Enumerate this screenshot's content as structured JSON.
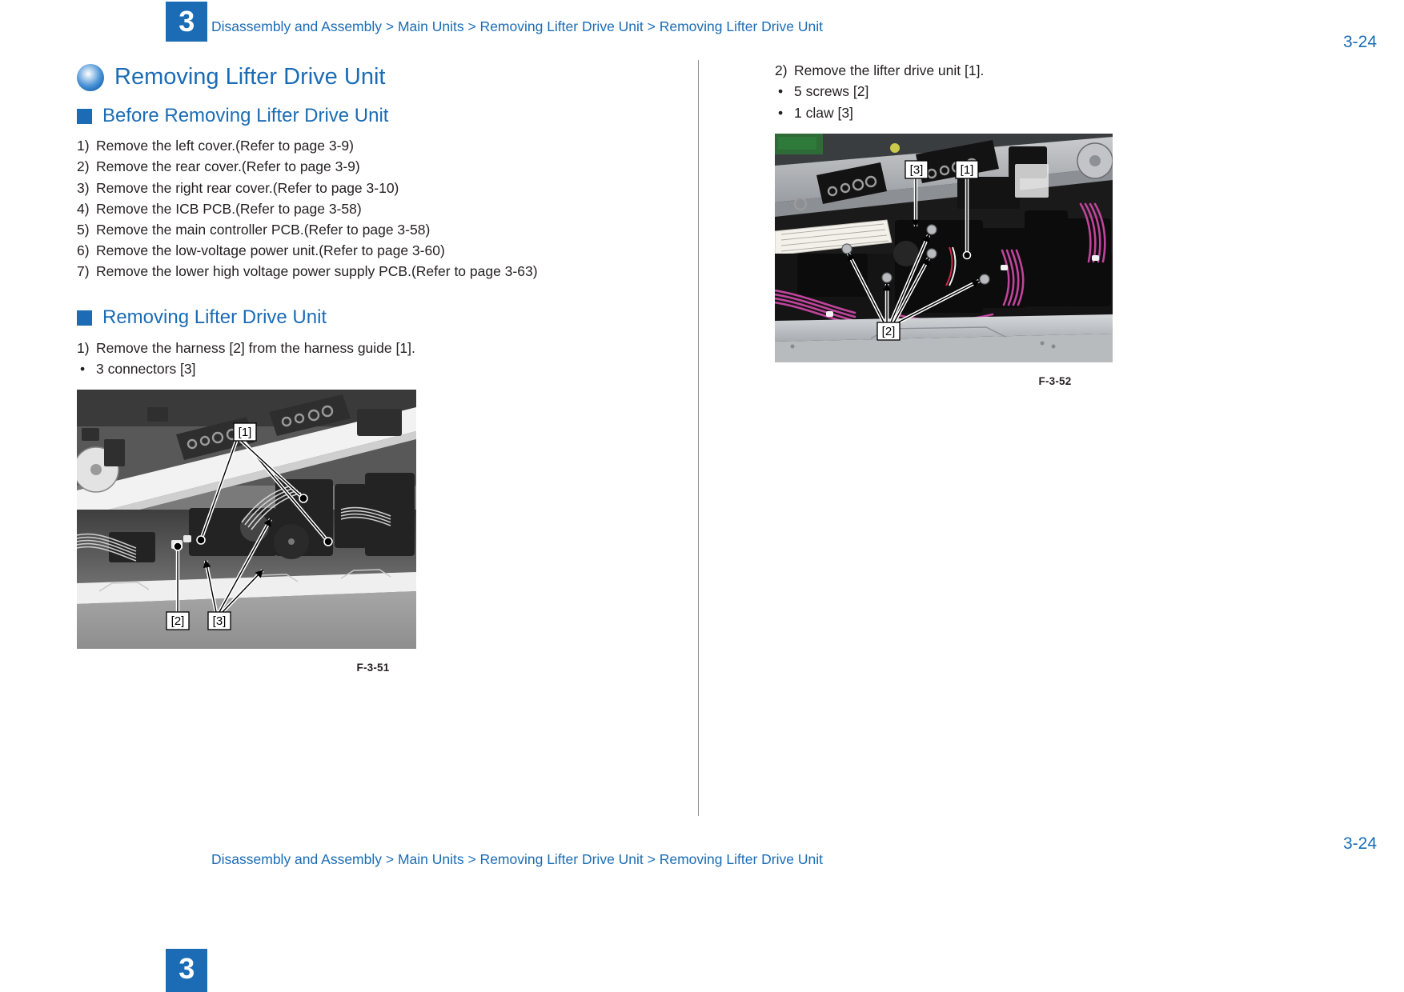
{
  "document": {
    "chapter_number": "3",
    "breadcrumb": "Disassembly and Assembly > Main Units > Removing Lifter Drive Unit > Removing Lifter Drive Unit",
    "page_number": "3-24",
    "accent_color": "#1b6cb5",
    "text_color": "#231f20"
  },
  "left_column": {
    "h1_title": "Removing Lifter Drive Unit",
    "section_before": {
      "heading": "Before Removing Lifter Drive Unit",
      "steps": [
        {
          "marker": "1)",
          "text": "Remove the left cover.(Refer to page 3-9)"
        },
        {
          "marker": "2)",
          "text": "Remove the rear cover.(Refer to page 3-9)"
        },
        {
          "marker": "3)",
          "text": "Remove the right rear cover.(Refer to page 3-10)"
        },
        {
          "marker": "4)",
          "text": "Remove the ICB PCB.(Refer to page 3-58)"
        },
        {
          "marker": "5)",
          "text": "Remove the main controller PCB.(Refer to page 3-58)"
        },
        {
          "marker": "6)",
          "text": "Remove the low-voltage power unit.(Refer to page 3-60)"
        },
        {
          "marker": "7)",
          "text": "Remove the lower high voltage power supply PCB.(Refer to page 3-63)"
        }
      ]
    },
    "section_removing": {
      "heading": "Removing Lifter Drive Unit",
      "steps": [
        {
          "marker": "1)",
          "text": "Remove the harness [2] from the harness guide [1]."
        }
      ],
      "bullets": [
        {
          "marker": "•",
          "text": "3 connectors [3]"
        }
      ]
    },
    "figure": {
      "caption": "F-3-51",
      "callouts": [
        "[1]",
        "[2]",
        "[3]"
      ],
      "description": "Grayscale photo of printer interior showing harness guide, harness and connectors"
    }
  },
  "right_column": {
    "steps": [
      {
        "marker": "2)",
        "text": "Remove the lifter drive unit [1]."
      }
    ],
    "bullets": [
      {
        "marker": "•",
        "text": "5 screws [2]"
      },
      {
        "marker": "•",
        "text": "1 claw [3]"
      }
    ],
    "figure": {
      "caption": "F-3-52",
      "callouts": [
        "[1]",
        "[2]",
        "[3]"
      ],
      "description": "Color photo of printer interior with magenta harnesses, lifter drive unit, screws and claw"
    }
  }
}
